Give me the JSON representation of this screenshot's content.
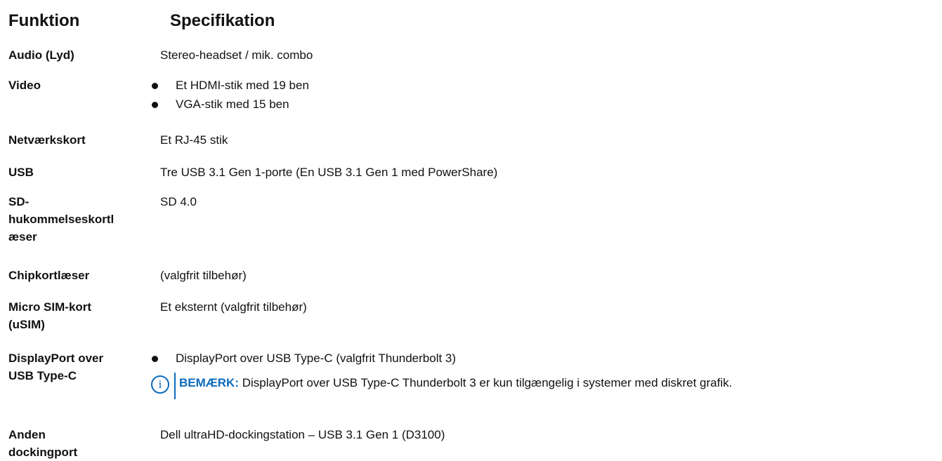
{
  "headers": {
    "feature": "Funktion",
    "spec": "Specifikation"
  },
  "rows": [
    {
      "feature": "Audio (Lyd)",
      "spec": "Stereo-headset / mik. combo"
    },
    {
      "feature": "Video",
      "bullets": [
        "Et HDMI-stik med 19 ben",
        "VGA-stik med 15 ben"
      ]
    },
    {
      "feature": "Netværkskort",
      "spec": "Et RJ-45 stik"
    },
    {
      "feature": "USB",
      "spec": "Tre USB 3.1 Gen 1-porte (En USB 3.1 Gen 1 med PowerShare)"
    },
    {
      "feature_lines": [
        "SD-",
        "hukommelseskortl",
        "æser"
      ],
      "spec": "SD 4.0"
    },
    {
      "feature": "Chipkortlæser",
      "spec": "(valgfrit tilbehør)"
    },
    {
      "feature_lines": [
        "Micro SIM-kort",
        "(uSIM)"
      ],
      "spec": "Et eksternt (valgfrit tilbehør)"
    },
    {
      "feature_lines": [
        "DisplayPort over",
        "USB Type-C"
      ],
      "bullets": [
        "DisplayPort over USB Type-C (valgfrit Thunderbolt 3)"
      ],
      "note": {
        "icon": "info-icon",
        "label": "BEMÆRK:",
        "text": "DisplayPort over USB Type-C Thunderbolt 3 er kun tilgængelig i systemer med diskret grafik."
      }
    },
    {
      "feature_lines": [
        "Anden",
        "dockingport"
      ],
      "spec": "Dell ultraHD-dockingstation – USB 3.1 Gen 1 (D3100)"
    }
  ],
  "colors": {
    "text": "#111111",
    "note_accent": "#0b6bbd"
  }
}
